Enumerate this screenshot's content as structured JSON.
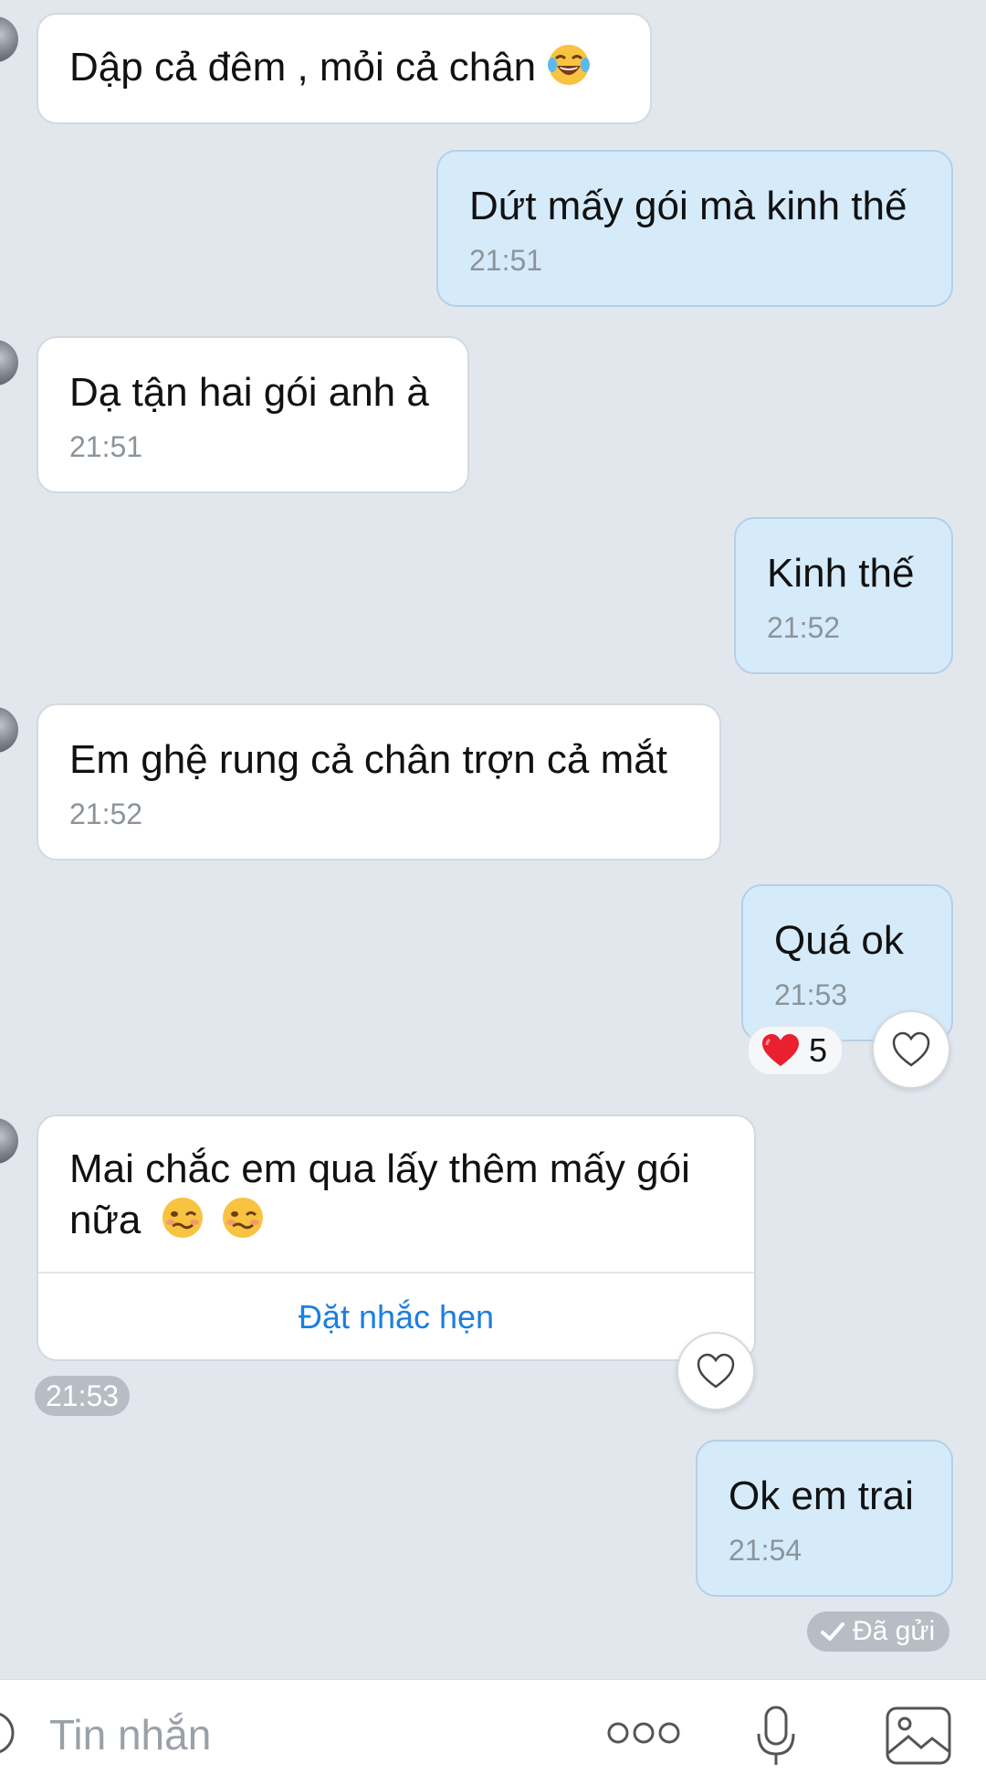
{
  "messages": [
    {
      "side": "in",
      "text": "Dập cả đêm , mỏi cả chân",
      "emoji": "face-with-tears-of-joy"
    },
    {
      "side": "out",
      "text": "Dứt mấy gói mà kinh thế",
      "time": "21:51"
    },
    {
      "side": "in",
      "text": "Dạ tận hai gói anh à",
      "time": "21:51"
    },
    {
      "side": "out",
      "text": "Kinh thế",
      "time": "21:52"
    },
    {
      "side": "in",
      "text": "Em ghệ rung cả chân trợn cả mắt",
      "time": "21:52"
    },
    {
      "side": "out",
      "text": "Quá ok",
      "time": "21:53",
      "reaction": {
        "emoji": "red-heart",
        "count": "5"
      }
    },
    {
      "side": "in",
      "text": "Mai chắc em qua lấy thêm mấy gói nữa",
      "emojis": [
        "woozy-face",
        "woozy-face"
      ],
      "action": "Đặt nhắc hẹn",
      "time": "21:53"
    },
    {
      "side": "out",
      "text": "Ok em trai",
      "time": "21:54",
      "status": "Đã gửi"
    }
  ],
  "composer": {
    "placeholder": "Tin nhắn",
    "icons": [
      "sticker-icon",
      "more-icon",
      "microphone-icon",
      "image-icon"
    ]
  },
  "colors": {
    "background": "#e2e7ee",
    "incoming_bubble": "#ffffff",
    "outgoing_bubble": "#d5ebfa",
    "link": "#1b7fe0"
  }
}
